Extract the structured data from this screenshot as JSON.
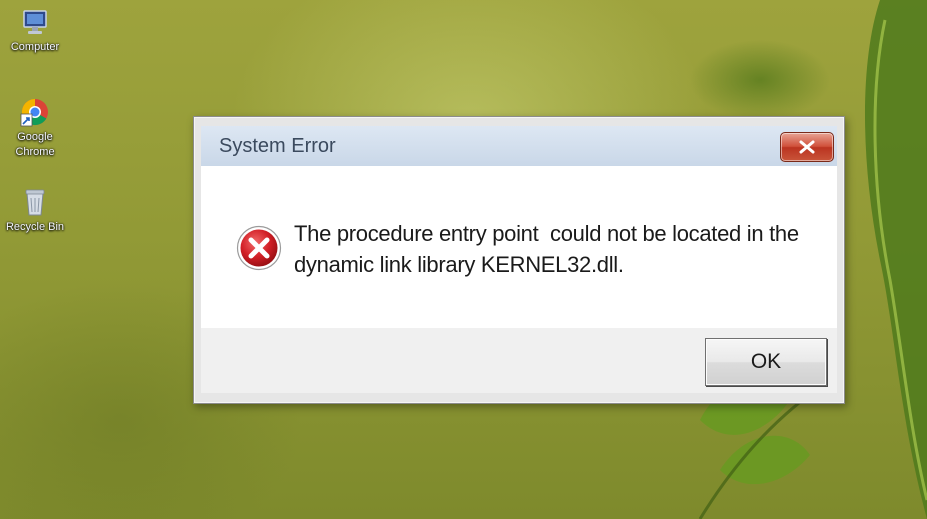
{
  "desktop": {
    "icons": [
      {
        "label": "Computer",
        "icon": "computer-icon"
      },
      {
        "label": "Google\nChrome",
        "icon": "chrome-icon"
      },
      {
        "label": "Recycle Bin",
        "icon": "recycle-bin-icon"
      }
    ]
  },
  "dialog": {
    "title": "System Error",
    "close_icon": "close-icon",
    "status_icon": "error-icon",
    "message": "The procedure entry point  could not be located in the dynamic link library KERNEL32.dll.",
    "ok_label": "OK"
  },
  "colors": {
    "titlebar": "#c9d7e8",
    "close_button": "#c9553a",
    "error_red": "#c4161c"
  }
}
